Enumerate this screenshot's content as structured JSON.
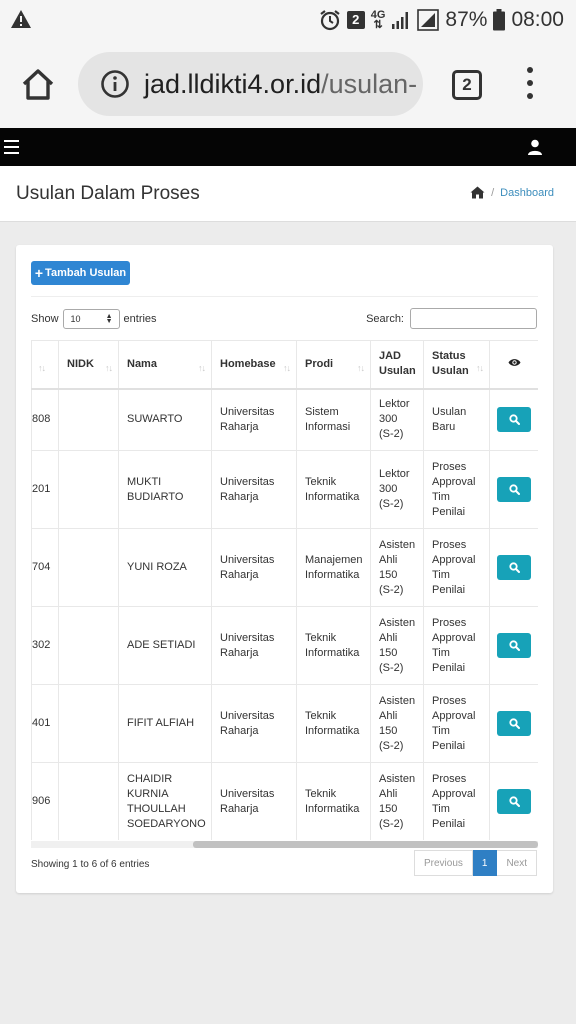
{
  "status_bar": {
    "badge": "2",
    "network": "4G",
    "battery": "87%",
    "time": "08:00",
    "icons": [
      "warning-icon",
      "alarm-icon",
      "signal-icon",
      "battery-icon"
    ]
  },
  "browser": {
    "url_domain": "jad.lldikti4.or.id",
    "url_path": "/usulan-",
    "tab_count": "2"
  },
  "page": {
    "title": "Usulan Dalam Proses",
    "breadcrumb_sep": "/",
    "breadcrumb_link": "Dashboard"
  },
  "toolbar": {
    "add_label": "Tambah Usulan"
  },
  "table_controls": {
    "show_label": "Show",
    "entries_label": "entries",
    "page_size": "10",
    "search_label": "Search:"
  },
  "table": {
    "columns": [
      "NIDK",
      "Nama",
      "Homebase",
      "Prodi",
      "JAD Usulan",
      "Status Usulan"
    ],
    "rows": [
      {
        "id": "808",
        "nidk": "",
        "nama": "SUWARTO",
        "homebase": "Universitas Raharja",
        "prodi": "Sistem Informasi",
        "jad": "Lektor 300 (S-2)",
        "status": "Usulan Baru"
      },
      {
        "id": "201",
        "nidk": "",
        "nama": "MUKTI BUDIARTO",
        "homebase": "Universitas Raharja",
        "prodi": "Teknik Informatika",
        "jad": "Lektor 300 (S-2)",
        "status": "Proses Approval Tim Penilai"
      },
      {
        "id": "704",
        "nidk": "",
        "nama": "YUNI ROZA",
        "homebase": "Universitas Raharja",
        "prodi": "Manajemen Informatika",
        "jad": "Asisten Ahli 150 (S-2)",
        "status": "Proses Approval Tim Penilai"
      },
      {
        "id": "302",
        "nidk": "",
        "nama": "ADE SETIADI",
        "homebase": "Universitas Raharja",
        "prodi": "Teknik Informatika",
        "jad": "Asisten Ahli 150 (S-2)",
        "status": "Proses Approval Tim Penilai"
      },
      {
        "id": "401",
        "nidk": "",
        "nama": "FIFIT ALFIAH",
        "homebase": "Universitas Raharja",
        "prodi": "Teknik Informatika",
        "jad": "Asisten Ahli 150 (S-2)",
        "status": "Proses Approval Tim Penilai"
      },
      {
        "id": "906",
        "nidk": "",
        "nama": "CHAIDIR KURNIA THOULLAH SOEDARYONO",
        "homebase": "Universitas Raharja",
        "prodi": "Teknik Informatika",
        "jad": "Asisten Ahli 150 (S-2)",
        "status": "Proses Approval Tim Penilai"
      }
    ]
  },
  "footer": {
    "info": "Showing 1 to 6 of 6 entries",
    "prev": "Previous",
    "current_page": "1",
    "next": "Next"
  },
  "colors": {
    "primary": "#2f86d3",
    "info_button": "#17a2b8",
    "link": "#3c8dbc",
    "navbar": "#050505"
  }
}
